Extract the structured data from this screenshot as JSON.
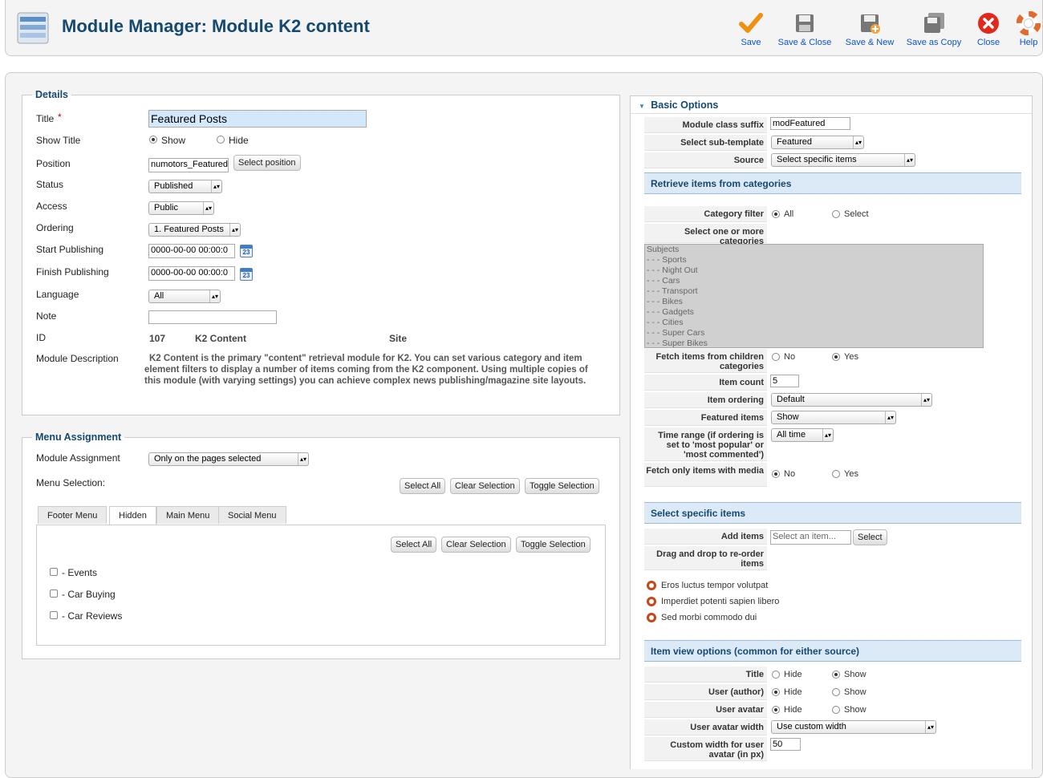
{
  "header": {
    "title": "Module Manager: Module K2 content"
  },
  "toolbar": {
    "save": "Save",
    "save_close": "Save & Close",
    "save_new": "Save & New",
    "save_copy": "Save as Copy",
    "close": "Close",
    "help": "Help"
  },
  "details": {
    "legend": "Details",
    "required_mark": "*",
    "title_label": "Title",
    "title_value": "Featured Posts",
    "show_title_label": "Show Title",
    "show_opt": "Show",
    "hide_opt": "Hide",
    "position_label": "Position",
    "position_value": "numotors_Featured",
    "select_position": "Select position",
    "status_label": "Status",
    "status_value": "Published",
    "access_label": "Access",
    "access_value": "Public",
    "ordering_label": "Ordering",
    "ordering_value": "1. Featured Posts",
    "start_label": "Start Publishing",
    "start_value": "0000-00-00 00:00:0",
    "finish_label": "Finish Publishing",
    "finish_value": "0000-00-00 00:00:0",
    "cal_day": "23",
    "language_label": "Language",
    "language_value": "All",
    "note_label": "Note",
    "id_label": "ID",
    "id_value": "107",
    "id_name": "K2 Content",
    "id_site": "Site",
    "desc_label": "Module Description",
    "desc_text": "K2 Content is the primary \"content\" retrieval module for K2. You can set various category and item element filters to display a number of items coming from the K2 component. Using multiple copies of this module (with varying settings) you can achieve complex news publishing/magazine site layouts."
  },
  "menu": {
    "legend": "Menu Assignment",
    "assign_label": "Module Assignment",
    "assign_value": "Only on the pages selected",
    "selection_label": "Menu Selection:",
    "select_all": "Select All",
    "clear_selection": "Clear Selection",
    "toggle_selection": "Toggle Selection",
    "tabs": [
      "Footer Menu",
      "Hidden",
      "Main Menu",
      "Social Menu"
    ],
    "items": [
      "- Events",
      "- Car Buying",
      "- Car Reviews"
    ]
  },
  "basic": {
    "title": "Basic Options",
    "class_suffix_label": "Module class suffix",
    "class_suffix_value": "modFeatured",
    "subtemplate_label": "Select sub-template",
    "subtemplate_value": "Featured",
    "source_label": "Source",
    "source_value": "Select specific items",
    "retrieve_hdr": "Retrieve items from categories",
    "cat_filter_label": "Category filter",
    "all_opt": "All",
    "select_opt": "Select",
    "cats_label": "Select one or more categories",
    "categories": [
      "Subjects",
      "- - - Sports",
      "- - - Night Out",
      "- - - Cars",
      "- - - Transport",
      "- - - Bikes",
      "- - - Gadgets",
      "- - - Cities",
      "- - - Super Cars",
      "- - - Super Bikes"
    ],
    "children_label": "Fetch items from children categories",
    "no_opt": "No",
    "yes_opt": "Yes",
    "count_label": "Item count",
    "count_value": "5",
    "ordering_label": "Item ordering",
    "ordering_value": "Default",
    "featured_label": "Featured items",
    "featured_value": "Show",
    "timerange_label": "Time range (if ordering is set to 'most popular' or 'most commented')",
    "timerange_value": "All time",
    "media_label": "Fetch only items with media",
    "specific_hdr": "Select specific items",
    "add_label": "Add items",
    "add_placeholder": "Select an item...",
    "select_btn": "Select",
    "drag_label": "Drag and drop to re-order items",
    "selected_items": [
      "Eros luctus tempor volutpat",
      "Imperdiet potenti sapien libero",
      "Sed morbi commodo dui"
    ],
    "view_hdr": "Item view options (common for either source)",
    "title_label": "Title",
    "hide_opt": "Hide",
    "show_opt": "Show",
    "author_label": "User (author)",
    "avatar_label": "User avatar",
    "avatar_width_label": "User avatar width",
    "avatar_width_value": "Use custom width",
    "custom_width_label": "Custom width for user avatar (in px)",
    "custom_width_value": "50"
  }
}
